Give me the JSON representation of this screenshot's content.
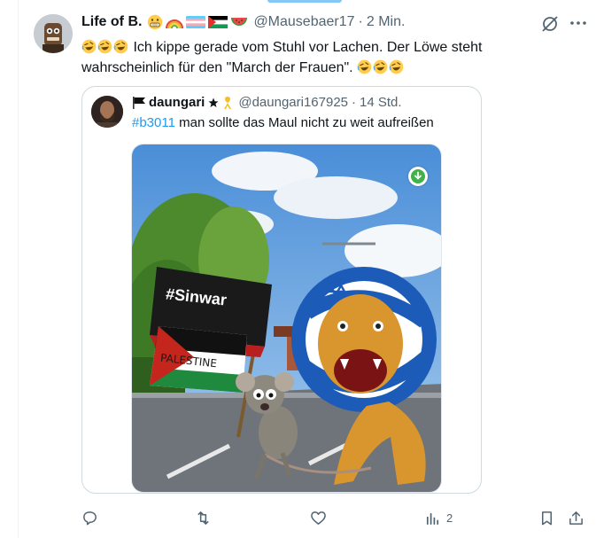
{
  "post": {
    "author_name": "Life of B.",
    "handle": "@Mausebaer17",
    "separator": "·",
    "time": "2 Min.",
    "text_before": "Ich kippe gerade vom Stuhl vor Lachen. Der Löwe steht wahrscheinlich für den \"March der Frauen\".",
    "name_emojis": [
      "grimacing-face",
      "rainbow",
      "trans-flag",
      "palestine-flag",
      "watermelon"
    ],
    "laugh_emoji": "rolling-on-floor-laughing"
  },
  "quote": {
    "author_name": "daungari",
    "handle": "@daungari167925",
    "separator": "·",
    "time": "14 Std.",
    "hashtag": "#b3011",
    "text": " man sollte das Maul nicht zu weit aufreißen",
    "image": {
      "flag_text": "#Sinwar",
      "sign_text": "PALESTINE",
      "description_icon": "download-badge"
    }
  },
  "actions": {
    "reply_count": "",
    "repost_count": "",
    "like_count": "",
    "views_count": "2"
  },
  "colors": {
    "accent": "#1d9bf0",
    "secondary_text": "#536471",
    "border": "#cfd9de"
  }
}
